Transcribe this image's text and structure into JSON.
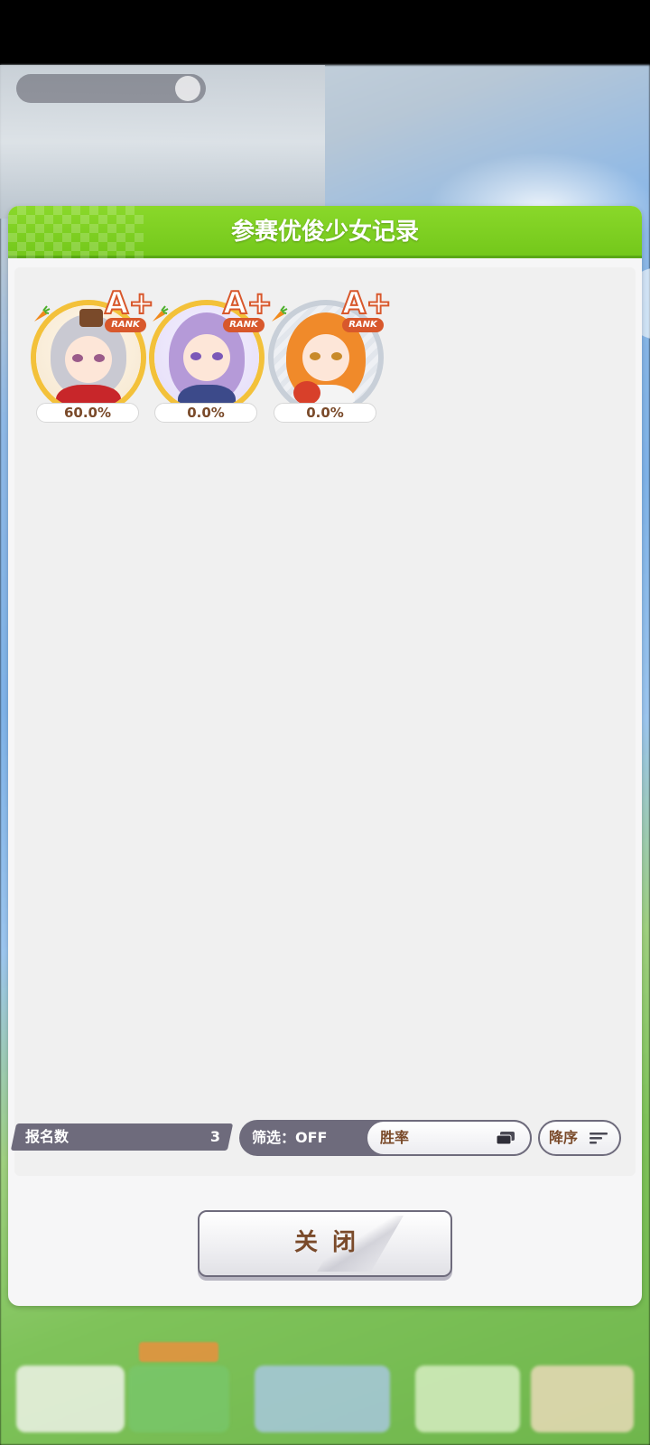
{
  "dialog": {
    "title": "参赛优俊少女记录",
    "close_label": "关闭"
  },
  "characters": [
    {
      "name_icon": "character-portrait",
      "rank": "A+",
      "rank_word": "RANK",
      "win_rate": "60.0%",
      "frame": "gold"
    },
    {
      "name_icon": "character-portrait",
      "rank": "A+",
      "rank_word": "RANK",
      "win_rate": "0.0%",
      "frame": "gold"
    },
    {
      "name_icon": "character-portrait",
      "rank": "A+",
      "rank_word": "RANK",
      "win_rate": "0.0%",
      "frame": "silver"
    }
  ],
  "footer": {
    "count_label": "报名数",
    "count_value": "3",
    "filter_label": "筛选：OFF",
    "sort_label": "胜率",
    "order_label": "降序"
  },
  "colors": {
    "header_green": "#7ccd22",
    "accent_brown": "#7a4a2a",
    "rank_orange": "#d8582c",
    "gold_frame": "#f3c13a",
    "bar_gray": "#6e6b7c"
  }
}
